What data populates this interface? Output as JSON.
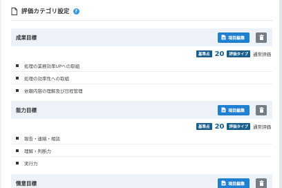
{
  "header": {
    "title": "評価カテゴリ設定",
    "help": "?"
  },
  "buttons": {
    "edit_label": "項目編集"
  },
  "labels": {
    "basic_points": "基準点",
    "eval_type": "評価タイプ"
  },
  "categories": [
    {
      "name": "成果目標",
      "score": "20",
      "type": "通常評価",
      "items": [
        "処理の業務効率UPへの取組",
        "処理の効率性への取組",
        "依頼内容の理解及び日程管理"
      ]
    },
    {
      "name": "能力目標",
      "score": "20",
      "type": "通常評価",
      "items": [
        "報告・連絡・相談",
        "理解・判断力",
        "実行力"
      ]
    },
    {
      "name": "情意目標"
    }
  ]
}
